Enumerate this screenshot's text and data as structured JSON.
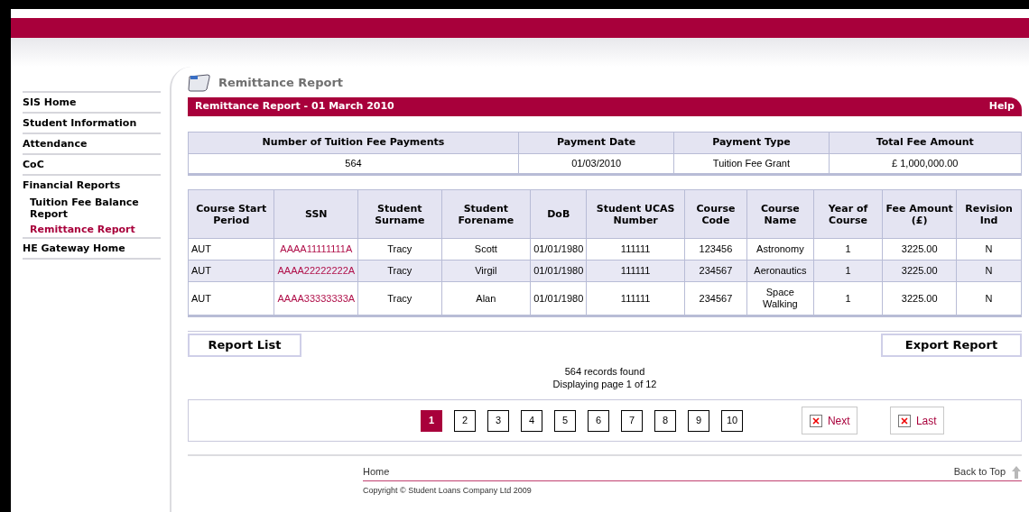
{
  "sidebar": {
    "items": [
      {
        "label": "SIS Home",
        "kind": "top",
        "selected": false
      },
      {
        "label": "Student Information",
        "kind": "top",
        "selected": false
      },
      {
        "label": "Attendance",
        "kind": "top",
        "selected": false
      },
      {
        "label": "CoC",
        "kind": "top",
        "selected": false
      },
      {
        "label": "Financial Reports",
        "kind": "top",
        "selected": false
      },
      {
        "label": "Tuition Fee Balance Report",
        "kind": "sub",
        "selected": false
      },
      {
        "label": "Remittance Report",
        "kind": "sub",
        "selected": true
      },
      {
        "label": "HE Gateway Home",
        "kind": "top",
        "selected": false
      }
    ]
  },
  "page_title": "Remittance Report",
  "report_bar": {
    "title": "Remittance Report - 01 March 2010",
    "help": "Help"
  },
  "summary": {
    "columns": [
      "Number of Tuition Fee Payments",
      "Payment Date",
      "Payment Type",
      "Total Fee Amount"
    ],
    "row": [
      "564",
      "01/03/2010",
      "Tuition Fee Grant",
      "£ 1,000,000.00"
    ]
  },
  "table": {
    "columns": [
      "Course Start Period",
      "SSN",
      "Student Surname",
      "Student Forename",
      "DoB",
      "Student UCAS Number",
      "Course Code",
      "Course Name",
      "Year of Course",
      "Fee Amount (£)",
      "Revision Ind"
    ],
    "rows": [
      [
        "AUT",
        "AAAA11111111A",
        "Tracy",
        "Scott",
        "01/01/1980",
        "111111",
        "123456",
        "Astronomy",
        "1",
        "3225.00",
        "N"
      ],
      [
        "AUT",
        "AAAA22222222A",
        "Tracy",
        "Virgil",
        "01/01/1980",
        "111111",
        "234567",
        "Aeronautics",
        "1",
        "3225.00",
        "N"
      ],
      [
        "AUT",
        "AAAA33333333A",
        "Tracy",
        "Alan",
        "01/01/1980",
        "111111",
        "234567",
        "Space Walking",
        "1",
        "3225.00",
        "N"
      ]
    ]
  },
  "buttons": {
    "report_list": "Report List",
    "export_report": "Export Report"
  },
  "records_found": "564 records found",
  "displaying": "Displaying page 1 of 12",
  "pagination": {
    "pages": [
      {
        "label": "1",
        "selected": true
      },
      {
        "label": "2",
        "selected": false
      },
      {
        "label": "3",
        "selected": false
      },
      {
        "label": "4",
        "selected": false
      },
      {
        "label": "5",
        "selected": false
      },
      {
        "label": "6",
        "selected": false
      },
      {
        "label": "7",
        "selected": false
      },
      {
        "label": "8",
        "selected": false
      },
      {
        "label": "9",
        "selected": false
      },
      {
        "label": "10",
        "selected": false
      }
    ],
    "next": "Next",
    "last": "Last"
  },
  "footer": {
    "home": "Home",
    "back_to_top": "Back to Top",
    "copyright": "Copyright © Student Loans Company Ltd 2009"
  }
}
